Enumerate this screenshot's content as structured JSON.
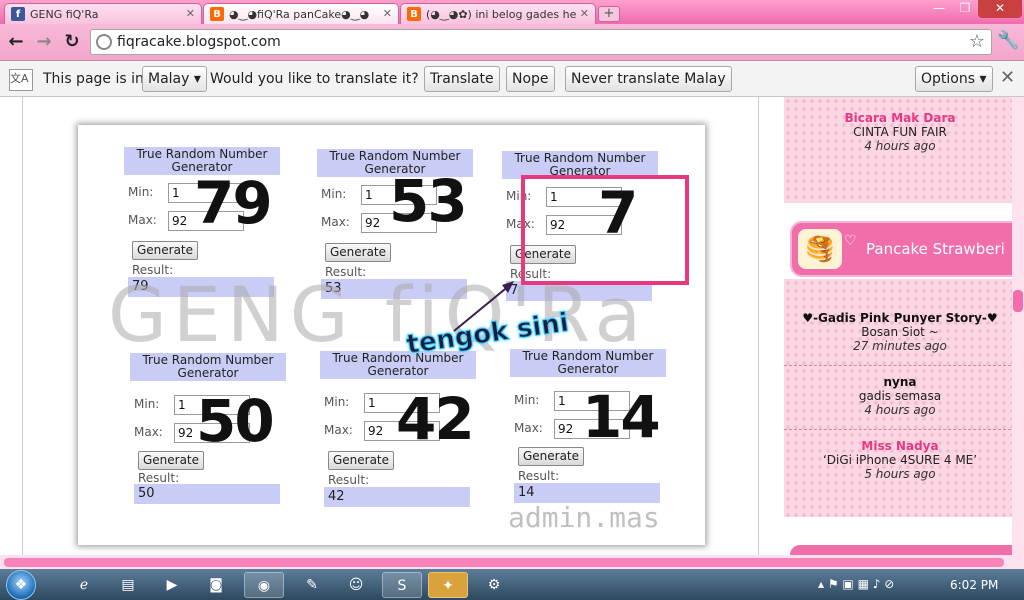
{
  "tabs": [
    {
      "favicon": "f",
      "title": "GENG fiQ'Ra"
    },
    {
      "favicon": "B",
      "title": "◕‿◕fiQ'Ra panCake◕‿◕"
    },
    {
      "favicon": "B",
      "title": "(◕‿◕✿) ini belog gades he"
    }
  ],
  "window": {
    "minimize": "—",
    "maximize": "❐",
    "close": "✕"
  },
  "toolbar": {
    "url": "fiqracake.blogspot.com"
  },
  "translate": {
    "prefix": "This page is in",
    "language": "Malay",
    "question": "Would you like to translate it?",
    "translate_btn": "Translate",
    "nope_btn": "Nope",
    "never_btn": "Never translate Malay",
    "options_btn": "Options"
  },
  "photo": {
    "watermark": "GENG fiQ'Ra",
    "signature": "admin.mas",
    "annotation": "tengok sini",
    "generators": [
      {
        "header": "True Random Number Generator",
        "min_label": "Min:",
        "max_label": "Max:",
        "min": "1",
        "max": "92",
        "button": "Generate",
        "result_label": "Result:",
        "result": "79",
        "big": "79"
      },
      {
        "header": "True Random Number Generator",
        "min_label": "Min:",
        "max_label": "Max:",
        "min": "1",
        "max": "92",
        "button": "Generate",
        "result_label": "Result:",
        "result": "53",
        "big": "53"
      },
      {
        "header": "True Random Number Generator",
        "min_label": "Min:",
        "max_label": "Max:",
        "min": "1",
        "max": "92",
        "button": "Generate",
        "result_label": "Result:",
        "result": "7",
        "big": "7"
      },
      {
        "header": "True Random Number Generator",
        "min_label": "Min:",
        "max_label": "Max:",
        "min": "1",
        "max": "92",
        "button": "Generate",
        "result_label": "Result:",
        "result": "50",
        "big": "50"
      },
      {
        "header": "True Random Number Generator",
        "min_label": "Min:",
        "max_label": "Max:",
        "min": "1",
        "max": "92",
        "button": "Generate",
        "result_label": "Result:",
        "result": "42",
        "big": "42"
      },
      {
        "header": "True Random Number Generator",
        "min_label": "Min:",
        "max_label": "Max:",
        "min": "1",
        "max": "92",
        "button": "Generate",
        "result_label": "Result:",
        "result": "14",
        "big": "14"
      }
    ]
  },
  "sidebar": {
    "top_entry": {
      "title": "Bicara Mak Dara",
      "subtitle": "CINTA FUN FAIR",
      "time": "4 hours ago"
    },
    "pancake_title": "Pancake Strawberi",
    "entries": [
      {
        "title": "♥-Gadis Pink Punyer Story-♥",
        "subtitle": "Bosan Siot ~",
        "time": "27 minutes ago"
      },
      {
        "title": "nyna",
        "subtitle": "gadis semasa",
        "time": "4 hours ago"
      },
      {
        "title": "Miss Nadya",
        "subtitle": "‘DiGi iPhone 4SURE 4 ME’",
        "time": "5 hours ago"
      }
    ]
  },
  "taskbar": {
    "clock": "6:02 PM"
  },
  "colors": {
    "accent_pink": "#e8387f",
    "toolbar_pink": "#f8b9d8",
    "generator_blue": "#c9cdf5"
  }
}
